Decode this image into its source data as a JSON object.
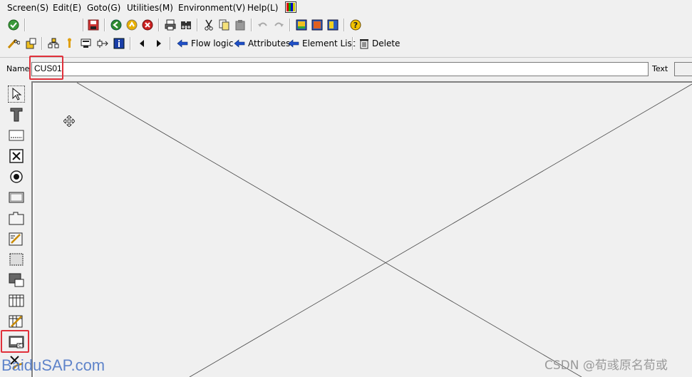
{
  "menu": [
    "Screen(S)",
    "Edit(E)",
    "Goto(G)",
    "Utilities(M)",
    "Environment(V)",
    "Help(L)"
  ],
  "toolbar2": {
    "flow_logic": "Flow logic",
    "attributes": "Attributes",
    "element_list": "Element List",
    "delete": "Delete"
  },
  "name_bar": {
    "label": "Name",
    "value": "CUS01",
    "text_label": "Text"
  },
  "watermark": {
    "left": "BaiduSAP.com",
    "right": "CSDN @荀彧原名荀或"
  },
  "colors": {
    "highlight": "#e0303a",
    "accent": "#1f4fc8"
  }
}
